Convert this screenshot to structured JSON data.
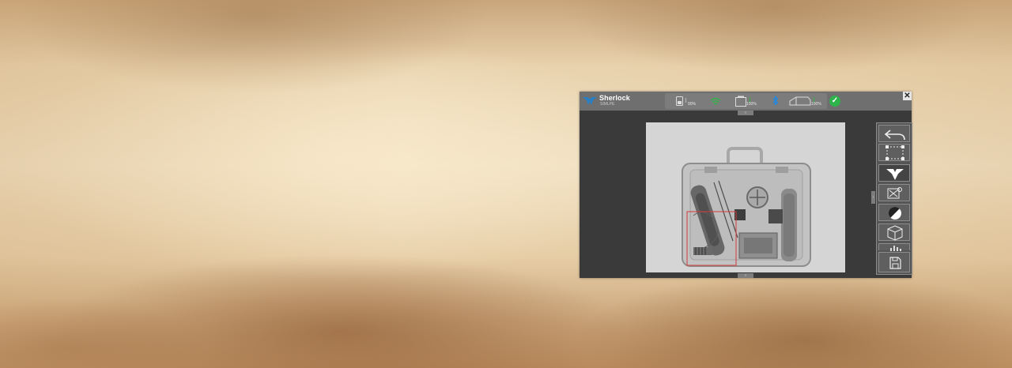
{
  "app": {
    "brand": "Sherlock",
    "brand_sub": "SIMLPE"
  },
  "status": {
    "device_battery": "90%",
    "unit_battery": "100%",
    "source_battery": "100%"
  },
  "colors": {
    "ok": "#2db34a",
    "wifi": "#35b34a",
    "bluetooth": "#1e88e5",
    "logo": "#2a7fc2",
    "roi": "#d23b3b"
  },
  "icons": [
    "tablet-battery-icon",
    "wifi-icon",
    "detector-battery-icon",
    "bluetooth-icon",
    "xray-source-icon",
    "check-icon",
    "close-icon",
    "undo-icon",
    "crop-icon",
    "logo-filter-icon",
    "zoom-icon",
    "contrast-icon",
    "3d-view-icon",
    "histogram-icon",
    "save-icon"
  ]
}
